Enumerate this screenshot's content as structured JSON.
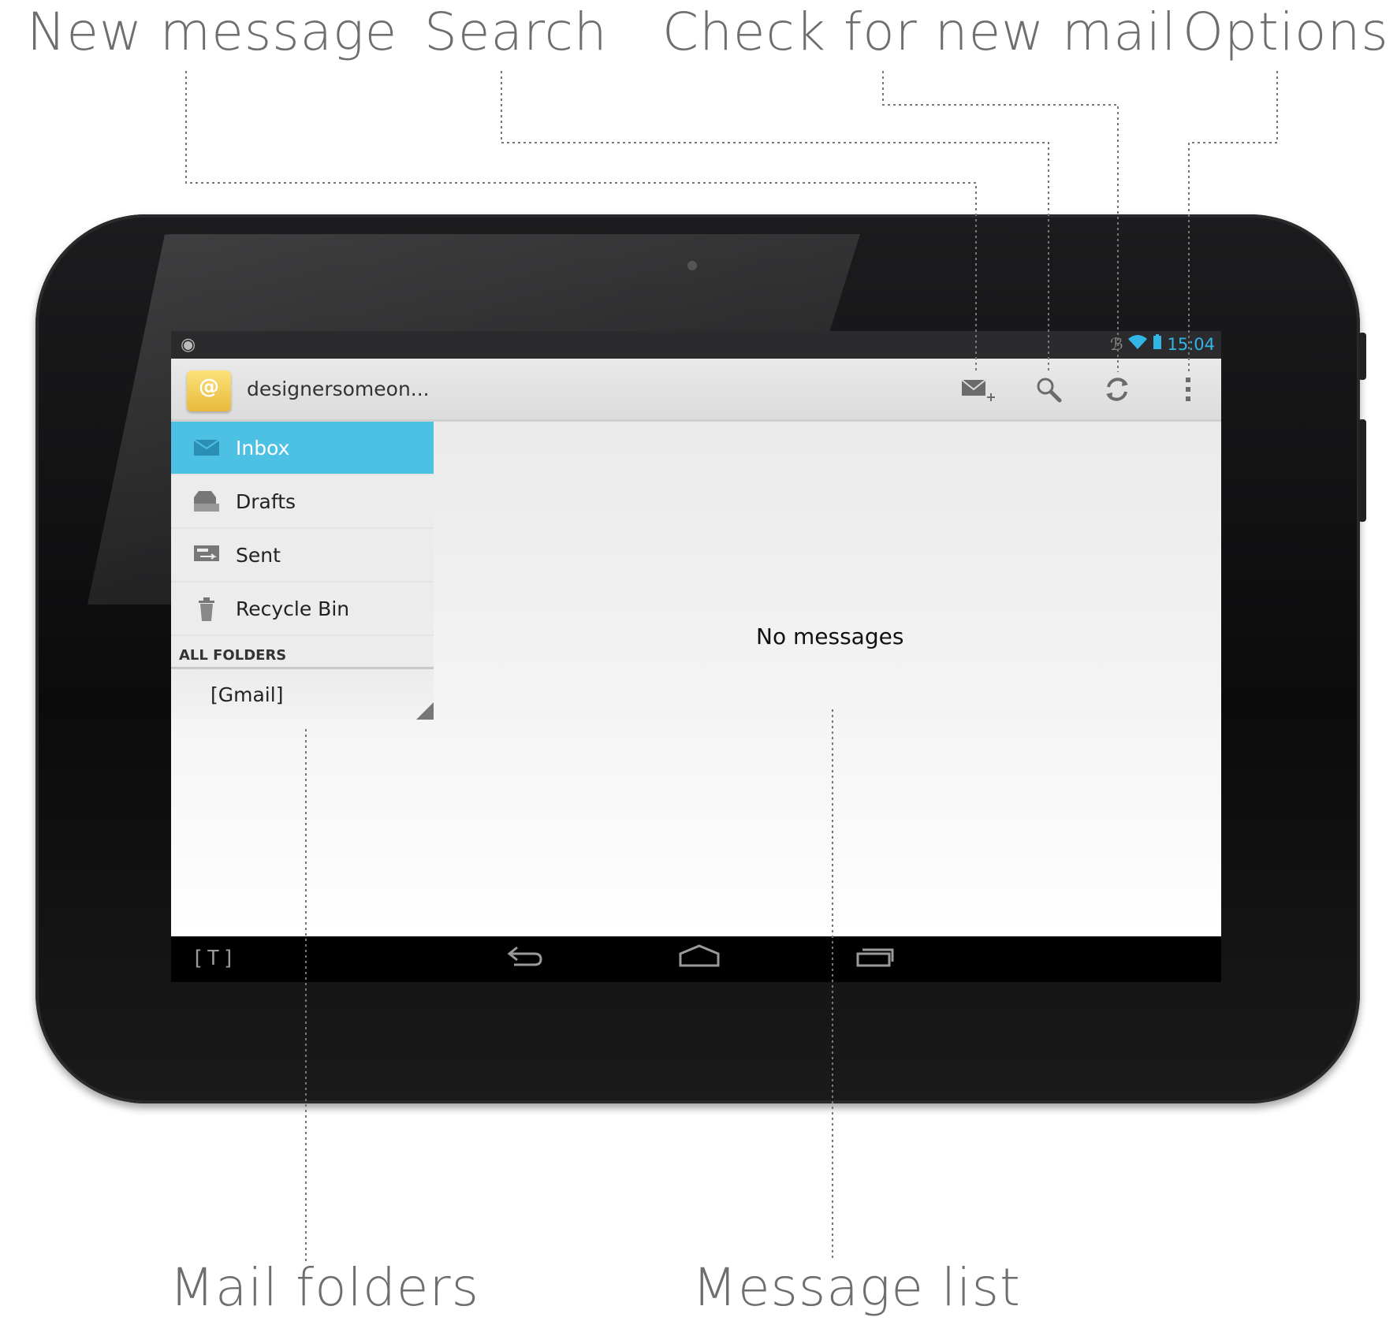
{
  "callouts": {
    "new_message": "New message",
    "search": "Search",
    "check_mail": "Check for new mail",
    "options": "Options",
    "mail_folders": "Mail folders",
    "message_list": "Message list"
  },
  "statusbar": {
    "time": "15:04",
    "icons": [
      "android-icon",
      "bluetooth-icon",
      "wifi-icon",
      "battery-icon"
    ]
  },
  "actionbar": {
    "account": "designersomeon...",
    "buttons": [
      "new-message-icon",
      "search-icon",
      "refresh-icon",
      "overflow-menu-icon"
    ]
  },
  "sidebar": {
    "folders": [
      {
        "label": "Inbox",
        "icon": "inbox-icon"
      },
      {
        "label": "Drafts",
        "icon": "drafts-icon"
      },
      {
        "label": "Sent",
        "icon": "sent-icon"
      },
      {
        "label": "Recycle Bin",
        "icon": "trash-icon"
      }
    ],
    "section_header": "ALL FOLDERS",
    "sub_folders": [
      {
        "label": "[Gmail]"
      }
    ]
  },
  "message_list": {
    "empty_text": "No messages"
  },
  "navbar": {
    "left_label": "[T]",
    "buttons": [
      "back-icon",
      "home-icon",
      "recent-apps-icon"
    ]
  },
  "colors": {
    "accent": "#4cc1e4",
    "callout_text": "#6e6e6e",
    "status_text": "#33b5e5"
  }
}
